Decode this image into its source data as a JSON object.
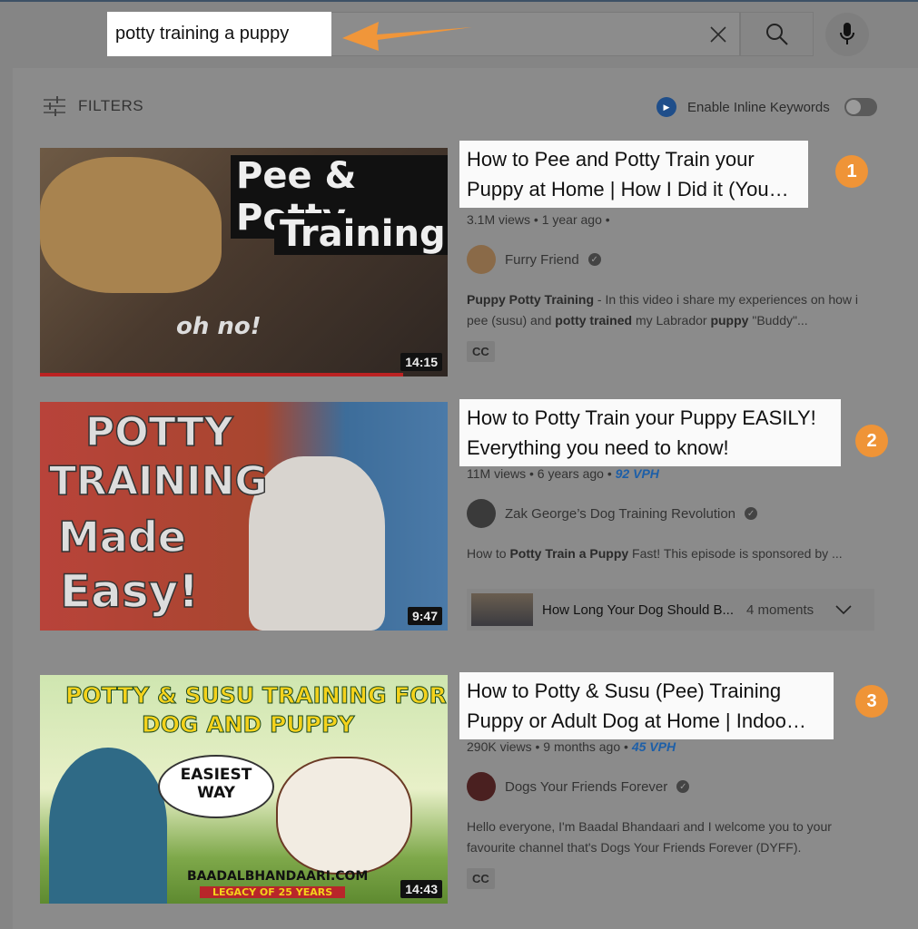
{
  "search": {
    "query": "potty training a puppy",
    "clear_icon": "close-icon",
    "search_icon": "search-icon",
    "mic_icon": "mic-icon"
  },
  "annotation": {
    "arrow_color": "#f0963a"
  },
  "filters": {
    "label": "FILTERS",
    "inline_keywords_label": "Enable Inline Keywords",
    "inline_keywords_enabled": false
  },
  "results": [
    {
      "rank": "1",
      "title": "How to Pee and Potty Train your Puppy at Home | How I Did it (You…",
      "views": "3.1M views",
      "age": "1 year ago",
      "vph": "",
      "channel": "Furry Friend",
      "description_html": "<b>Puppy Potty Training</b> - In this video i share my experiences on how i pee (susu) and <b>potty trained</b> my Labrador <b>puppy</b> \"Buddy\"...",
      "cc": "CC",
      "duration": "14:15",
      "thumb_text": [
        "Pee & Potty",
        "Training",
        "oh no!"
      ]
    },
    {
      "rank": "2",
      "title": "How to Potty Train your Puppy EASILY! Everything you need to know!",
      "views": "11M views",
      "age": "6 years ago",
      "vph": "92 VPH",
      "channel": "Zak George’s Dog Training Revolution",
      "description_html": "How to <b>Potty Train a Puppy</b> Fast! This episode is sponsored by ...",
      "duration": "9:47",
      "moments": {
        "title": "How Long Your Dog Should B...",
        "count": "4 moments"
      },
      "thumb_text": [
        "POTTY",
        "TRAINING",
        "Made",
        "Easy!"
      ]
    },
    {
      "rank": "3",
      "title": "How to Potty & Susu (Pee) Training Puppy or Adult Dog at Home | Indoo…",
      "views": "290K views",
      "age": "9 months ago",
      "vph": "45 VPH",
      "channel": "Dogs Your Friends Forever",
      "description_html": "Hello everyone, I'm Baadal Bhandaari and I welcome you to your favourite channel that's Dogs Your Friends Forever (DYFF).",
      "cc": "CC",
      "duration": "14:43",
      "thumb_text": [
        "POTTY & SUSU TRAINING FOR",
        "DOG AND PUPPY",
        "EASIEST",
        "WAY",
        "BAADALBHANDAARI.COM",
        "LEGACY OF 25 YEARS"
      ]
    }
  ]
}
